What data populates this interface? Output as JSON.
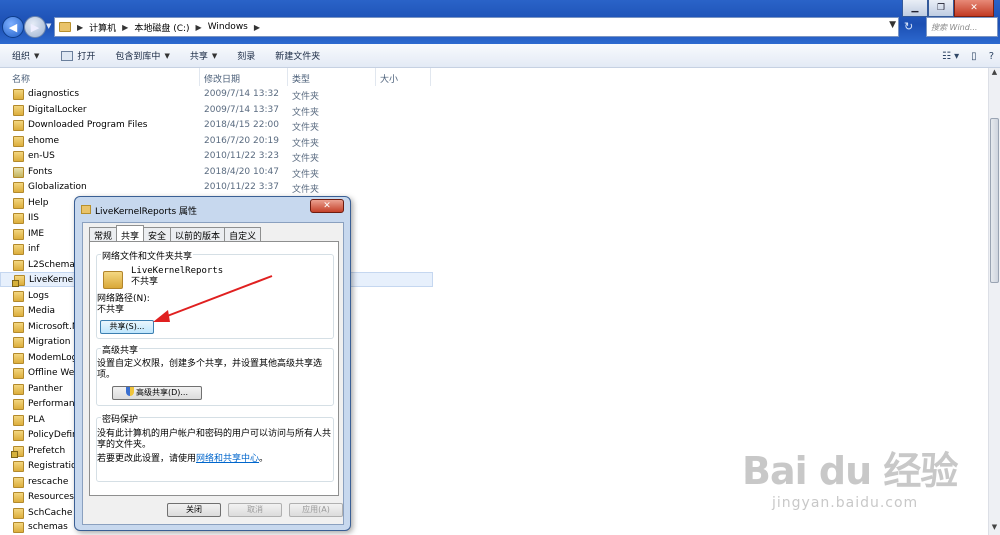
{
  "window": {
    "minimize": "▁",
    "maximize": "❐",
    "close": "✕"
  },
  "address": {
    "crumbs": [
      "计算机",
      "本地磁盘 (C:)",
      "Windows"
    ],
    "search_placeholder": "搜索 Wind..."
  },
  "toolbar": {
    "organize": "组织",
    "open": "打开",
    "include_in_library": "包含到库中",
    "share": "共享",
    "burn": "刻录",
    "new_folder": "新建文件夹"
  },
  "columns": {
    "name": "名称",
    "date": "修改日期",
    "type": "类型",
    "size": "大小"
  },
  "files": [
    {
      "name": "diagnostics",
      "date": "2009/7/14 13:32",
      "type": "文件夹"
    },
    {
      "name": "DigitalLocker",
      "date": "2009/7/14 13:37",
      "type": "文件夹"
    },
    {
      "name": "Downloaded Program Files",
      "date": "2018/4/15 22:00",
      "type": "文件夹"
    },
    {
      "name": "ehome",
      "date": "2016/7/20 20:19",
      "type": "文件夹"
    },
    {
      "name": "en-US",
      "date": "2010/11/22 3:23",
      "type": "文件夹"
    },
    {
      "name": "Fonts",
      "date": "2018/4/20 10:47",
      "type": "文件夹"
    },
    {
      "name": "Globalization",
      "date": "2010/11/22 3:37",
      "type": "文件夹"
    },
    {
      "name": "Help",
      "date": "",
      "type": ""
    },
    {
      "name": "IIS",
      "date": "",
      "type": ""
    },
    {
      "name": "IME",
      "date": "",
      "type": ""
    },
    {
      "name": "inf",
      "date": "",
      "type": ""
    },
    {
      "name": "L2Schemas",
      "date": "",
      "type": ""
    },
    {
      "name": "LiveKernelReports",
      "date": "",
      "type": ""
    },
    {
      "name": "Logs",
      "date": "",
      "type": ""
    },
    {
      "name": "Media",
      "date": "",
      "type": ""
    },
    {
      "name": "Microsoft.NET",
      "date": "",
      "type": ""
    },
    {
      "name": "Migration",
      "date": "",
      "type": ""
    },
    {
      "name": "ModemLogs",
      "date": "",
      "type": ""
    },
    {
      "name": "Offline Web Pages",
      "date": "",
      "type": ""
    },
    {
      "name": "Panther",
      "date": "",
      "type": ""
    },
    {
      "name": "Performance",
      "date": "",
      "type": ""
    },
    {
      "name": "PLA",
      "date": "",
      "type": ""
    },
    {
      "name": "PolicyDefinitions",
      "date": "",
      "type": ""
    },
    {
      "name": "Prefetch",
      "date": "",
      "type": ""
    },
    {
      "name": "Registration",
      "date": "",
      "type": ""
    },
    {
      "name": "rescache",
      "date": "",
      "type": ""
    },
    {
      "name": "Resources",
      "date": "",
      "type": ""
    },
    {
      "name": "SchCache",
      "date": "",
      "type": ""
    },
    {
      "name": "schemas",
      "date": "",
      "type": ""
    }
  ],
  "dialog": {
    "title": "LiveKernelReports 属性",
    "tabs": [
      "常规",
      "共享",
      "安全",
      "以前的版本",
      "自定义"
    ],
    "active_tab": "共享",
    "network_group_label": "网络文件和文件夹共享",
    "folder_name": "LiveKernelReports",
    "share_state": "不共享",
    "network_path_label": "网络路径(N):",
    "network_path_value": "不共享",
    "share_button": "共享(S)...",
    "advanced_group_label": "高级共享",
    "advanced_desc": "设置自定义权限，创建多个共享，并设置其他高级共享选项。",
    "advanced_button": "高级共享(D)...",
    "password_group_label": "密码保护",
    "password_desc": "没有此计算机的用户帐户和密码的用户可以访问与所有人共享的文件夹。",
    "password_change_prefix": "若要更改此设置，请使用",
    "password_link": "网络和共享中心",
    "password_change_suffix": "。",
    "close_button": "关闭",
    "cancel_button": "取消",
    "apply_button": "应用(A)"
  },
  "watermark": {
    "logo": "Bai du 经验",
    "site": "jingyan.baidu.com"
  },
  "colors": {
    "titlebar": "#1c4fb3",
    "dialog_frame": "#c7d8ee",
    "annotation_arrow": "#e02020",
    "link": "#0066cc"
  }
}
